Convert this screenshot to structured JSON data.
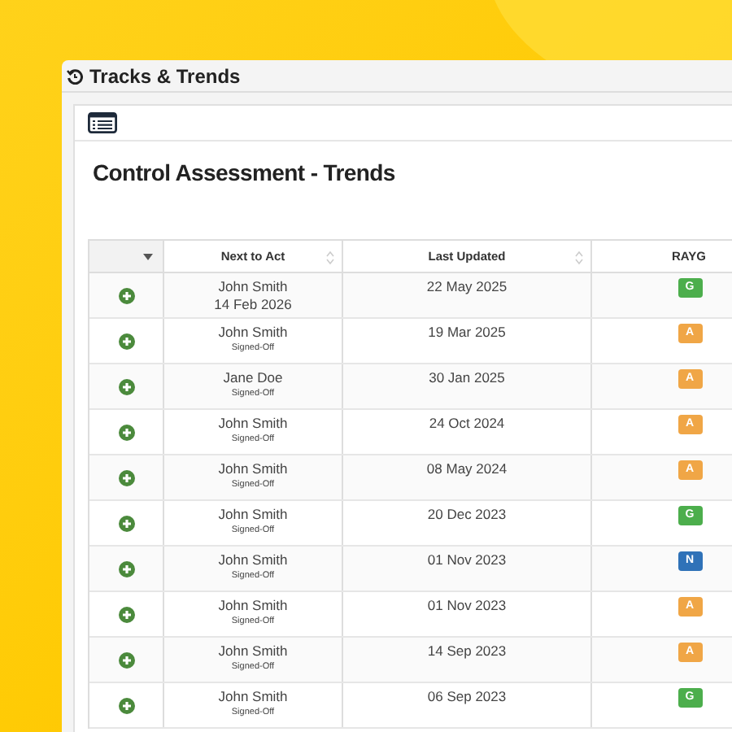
{
  "window": {
    "title": "Tracks & Trends"
  },
  "page": {
    "heading": "Control Assessment - Trends"
  },
  "table": {
    "columns": [
      "Next to Act",
      "Last Updated",
      "RAYG"
    ],
    "rows": [
      {
        "name": "John Smith",
        "detail": "14 Feb 2026",
        "kind": "date",
        "updated": "22 May 2025",
        "rating": "G",
        "color": "#4cae4c"
      },
      {
        "name": "John Smith",
        "detail": "Signed-Off",
        "kind": "status",
        "updated": "19 Mar 2025",
        "rating": "A",
        "color": "#f0a646"
      },
      {
        "name": "Jane Doe",
        "detail": "Signed-Off",
        "kind": "status",
        "updated": "30 Jan 2025",
        "rating": "A",
        "color": "#f0a646"
      },
      {
        "name": "John Smith",
        "detail": "Signed-Off",
        "kind": "status",
        "updated": "24 Oct 2024",
        "rating": "A",
        "color": "#f0a646"
      },
      {
        "name": "John Smith",
        "detail": "Signed-Off",
        "kind": "status",
        "updated": "08 May 2024",
        "rating": "A",
        "color": "#f0a646"
      },
      {
        "name": "John Smith",
        "detail": "Signed-Off",
        "kind": "status",
        "updated": "20 Dec 2023",
        "rating": "G",
        "color": "#4cae4c"
      },
      {
        "name": "John Smith",
        "detail": "Signed-Off",
        "kind": "status",
        "updated": "01 Nov 2023",
        "rating": "N",
        "color": "#2f72b8"
      },
      {
        "name": "John Smith",
        "detail": "Signed-Off",
        "kind": "status",
        "updated": "01 Nov 2023",
        "rating": "A",
        "color": "#f0a646"
      },
      {
        "name": "John Smith",
        "detail": "Signed-Off",
        "kind": "status",
        "updated": "14 Sep 2023",
        "rating": "A",
        "color": "#f0a646"
      },
      {
        "name": "John Smith",
        "detail": "Signed-Off",
        "kind": "status",
        "updated": "06 Sep 2023",
        "rating": "G",
        "color": "#4cae4c"
      }
    ]
  }
}
